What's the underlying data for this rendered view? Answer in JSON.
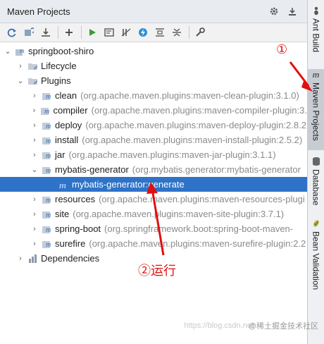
{
  "panel": {
    "title": "Maven Projects"
  },
  "tree": {
    "root": "springboot-shiro",
    "lifecycle": "Lifecycle",
    "plugins": "Plugins",
    "items": [
      {
        "name": "clean",
        "detail": "(org.apache.maven.plugins:maven-clean-plugin:3.1.0)"
      },
      {
        "name": "compiler",
        "detail": "(org.apache.maven.plugins:maven-compiler-plugin:3."
      },
      {
        "name": "deploy",
        "detail": "(org.apache.maven.plugins:maven-deploy-plugin:2.8.2"
      },
      {
        "name": "install",
        "detail": "(org.apache.maven.plugins:maven-install-plugin:2.5.2)"
      },
      {
        "name": "jar",
        "detail": "(org.apache.maven.plugins:maven-jar-plugin:3.1.1)"
      },
      {
        "name": "mybatis-generator",
        "detail": "(org.mybatis.generator:mybatis-generator"
      },
      {
        "name": "resources",
        "detail": "(org.apache.maven.plugins:maven-resources-plugi"
      },
      {
        "name": "site",
        "detail": "(org.apache.maven.plugins:maven-site-plugin:3.7.1)"
      },
      {
        "name": "spring-boot",
        "detail": "(org.springframework.boot:spring-boot-maven-"
      },
      {
        "name": "surefire",
        "detail": "(org.apache.maven.plugins:maven-surefire-plugin:2.2"
      }
    ],
    "goal": "mybatis-generator:generate",
    "dependencies": "Dependencies"
  },
  "right_strip": {
    "tabs": [
      "Ant Build",
      "Maven Projects",
      "Database",
      "Bean Validation"
    ]
  },
  "annotations": {
    "one": "①",
    "two": "②运行"
  },
  "watermark": {
    "url": "https://blog.csdn.net",
    "site": "@稀土掘金技术社区"
  },
  "colors": {
    "selection": "#2e73c8",
    "annotation": "#e01010"
  }
}
